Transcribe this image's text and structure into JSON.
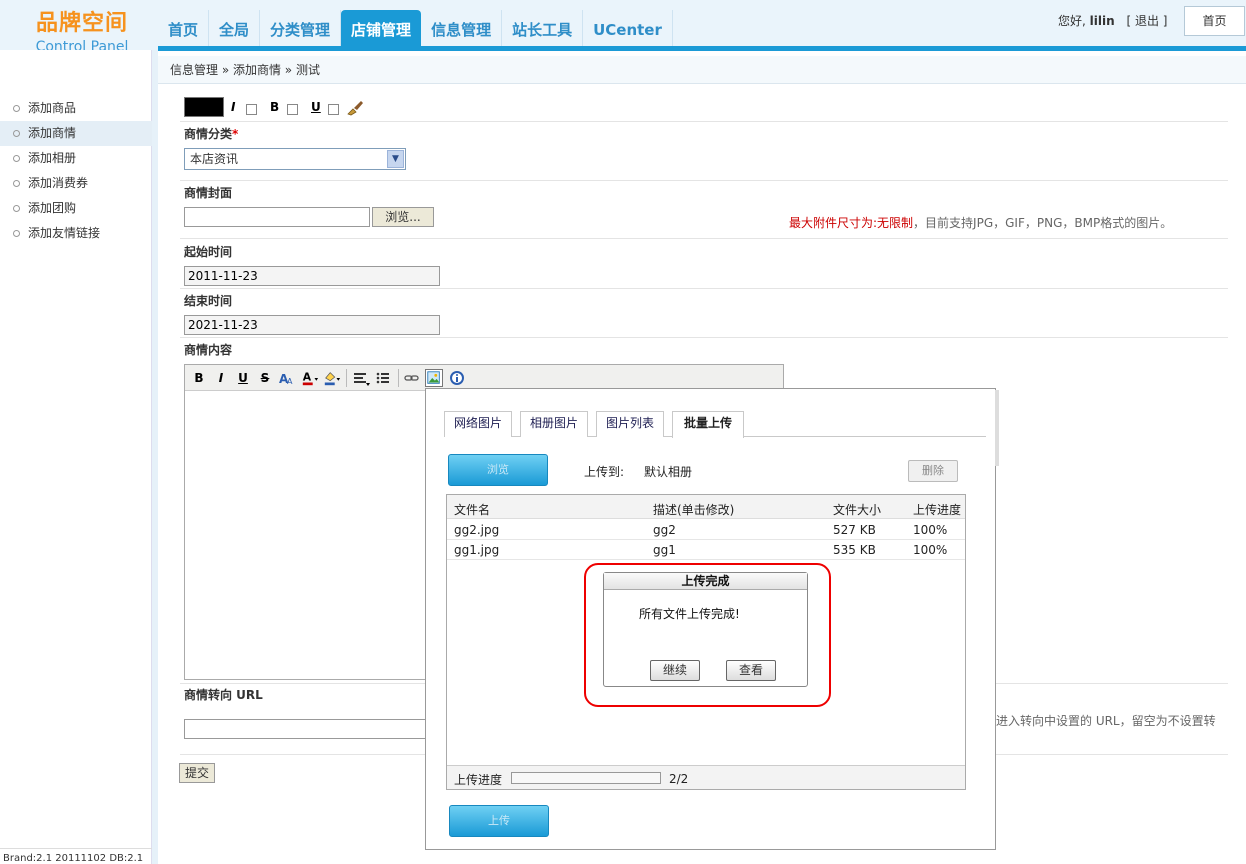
{
  "header": {
    "logo_cn": "品牌空间",
    "logo_en": "Control Panel",
    "nav": [
      "首页",
      "全局",
      "分类管理",
      "店铺管理",
      "信息管理",
      "站长工具",
      "UCenter"
    ],
    "greeting_prefix": "您好, ",
    "username": "lilin",
    "logout": "[ 退出 ]",
    "home_button": "首页"
  },
  "sidebar": {
    "items": [
      "添加商品",
      "添加商情",
      "添加相册",
      "添加消费券",
      "添加团购",
      "添加友情链接"
    ],
    "footer": "Brand:2.1 20111102 DB:2.1"
  },
  "breadcrumb": "信息管理 » 添加商情 » 测试",
  "form": {
    "style_letters": [
      "I",
      "B",
      "U"
    ],
    "category_label": "商情分类",
    "category_required": "*",
    "category_value": "本店资讯",
    "cover_label": "商情封面",
    "browse_button": "浏览...",
    "note_red": "最大附件尺寸为:无限制",
    "note_gray": "，目前支持JPG，GIF，PNG，BMP格式的图片。",
    "start_label": "起始时间",
    "start_value": "2011-11-23",
    "end_label": "结束时间",
    "end_value": "2021-11-23",
    "content_label": "商情内容",
    "redirect_label": "商情转向 URL",
    "redirect_hint": "进入转向中设置的 URL，留空为不设置转",
    "submit_button": "提交"
  },
  "editor_tools": [
    "B",
    "I",
    "U",
    "S"
  ],
  "dialog": {
    "tabs": [
      "网络图片",
      "相册图片",
      "图片列表",
      "批量上传"
    ],
    "browse_label": "浏览",
    "upload_to_label": "上传到:",
    "album": "默认相册",
    "delete_button": "删除",
    "columns": [
      "文件名",
      "描述(单击修改)",
      "文件大小",
      "上传进度"
    ],
    "files": [
      {
        "name": "gg2.jpg",
        "desc": "gg2",
        "size": "527 KB",
        "progress": "100%"
      },
      {
        "name": "gg1.jpg",
        "desc": "gg1",
        "size": "535 KB",
        "progress": "100%"
      }
    ],
    "progress_label": "上传进度",
    "progress_count": "2/2",
    "upload_button": "上传"
  },
  "popup": {
    "title": "上传完成",
    "message": "所有文件上传完成!",
    "continue_button": "继续",
    "view_button": "查看"
  },
  "colors": {
    "accent": "#1a9ad6",
    "logo_orange": "#f6921e",
    "highlight_ring": "#e00000"
  }
}
